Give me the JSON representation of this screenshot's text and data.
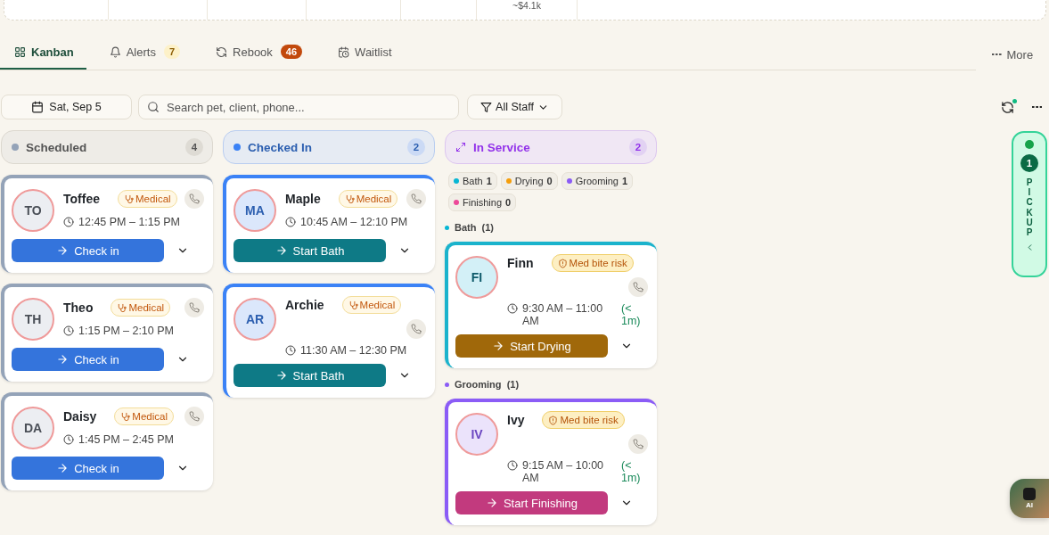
{
  "summary_strip": {
    "estimate": "~$4.1k"
  },
  "tabs": [
    {
      "label": "Kanban",
      "kind": "plain",
      "selected": true
    },
    {
      "label": "Alerts",
      "kind": "soft_count",
      "badge": "7",
      "selected": false
    },
    {
      "label": "Rebook",
      "kind": "strong_count",
      "badge": "46",
      "selected": false
    },
    {
      "label": "Waitlist",
      "kind": "plain",
      "selected": false
    }
  ],
  "more_button": {
    "label": "More"
  },
  "toolbar": {
    "date": "Sat, Sep 5",
    "search": {
      "placeholder": "Search pet, client, phone..."
    },
    "staff_filter": "All Staff",
    "sync_pending": true
  },
  "columns": [
    {
      "kind": "scheduled",
      "title": "Scheduled",
      "count": "4",
      "color": "#94a3b8",
      "cards": [
        {
          "initials": "TO",
          "name": "Toffee",
          "badge": {
            "kind": "medical",
            "label": "Medical"
          },
          "time": "12:45 PM – 1:15 PM",
          "action": {
            "kind": "check_in",
            "label": "Check in"
          }
        },
        {
          "initials": "TH",
          "name": "Theo",
          "badge": {
            "kind": "medical",
            "label": "Medical"
          },
          "time": "1:15 PM – 2:10 PM",
          "action": {
            "kind": "check_in",
            "label": "Check in"
          }
        },
        {
          "initials": "DA",
          "name": "Daisy",
          "badge": {
            "kind": "medical",
            "label": "Medical"
          },
          "time": "1:45 PM – 2:45 PM",
          "action": {
            "kind": "check_in",
            "label": "Check in"
          }
        }
      ]
    },
    {
      "kind": "checked_in",
      "title": "Checked In",
      "count": "2",
      "color": "#3b82f6",
      "cards": [
        {
          "initials": "MA",
          "name": "Maple",
          "badge": {
            "kind": "medical",
            "label": "Medical"
          },
          "time": "10:45 AM – 12:10 PM",
          "action": {
            "kind": "start_bath",
            "label": "Start Bath"
          }
        },
        {
          "initials": "AR",
          "name": "Archie",
          "badge": {
            "kind": "medical",
            "label": "Medical"
          },
          "time": "11:30 AM – 12:30 PM",
          "action": {
            "kind": "start_bath",
            "label": "Start Bath"
          }
        }
      ]
    },
    {
      "kind": "in_service",
      "title": "In Service",
      "count": "2",
      "color": "#9333ea",
      "stages": [
        {
          "label": "Bath",
          "count": "1",
          "color": "#06b6d4"
        },
        {
          "label": "Drying",
          "count": "0",
          "color": "#f59e0b"
        },
        {
          "label": "Grooming",
          "count": "1",
          "color": "#8b5cf6"
        },
        {
          "label": "Finishing",
          "count": "0",
          "color": "#ec4899"
        }
      ],
      "groups": [
        {
          "kind": "bath",
          "label": "Bath",
          "count": "(1)",
          "color": "#06b6d4",
          "cards": [
            {
              "initials": "FI",
              "name": "Finn",
              "badge": {
                "kind": "bite_risk",
                "label": "Med bite risk"
              },
              "time": "9:30 AM – 11:00 AM",
              "elapsed": "(< 1m)",
              "action": {
                "kind": "start_drying",
                "label": "Start Drying"
              }
            }
          ]
        },
        {
          "kind": "grooming",
          "label": "Grooming",
          "count": "(1)",
          "color": "#8b5cf6",
          "cards": [
            {
              "initials": "IV",
              "name": "Ivy",
              "badge": {
                "kind": "bite_risk",
                "label": "Med bite risk"
              },
              "time": "9:15 AM – 10:00 AM",
              "elapsed": "(< 1m)",
              "action": {
                "kind": "start_finishing",
                "label": "Start Finishing"
              }
            }
          ]
        }
      ]
    }
  ],
  "pickup_rail": {
    "count": "1",
    "label": "PICKUP"
  },
  "ai_button": {
    "label": "AI"
  }
}
